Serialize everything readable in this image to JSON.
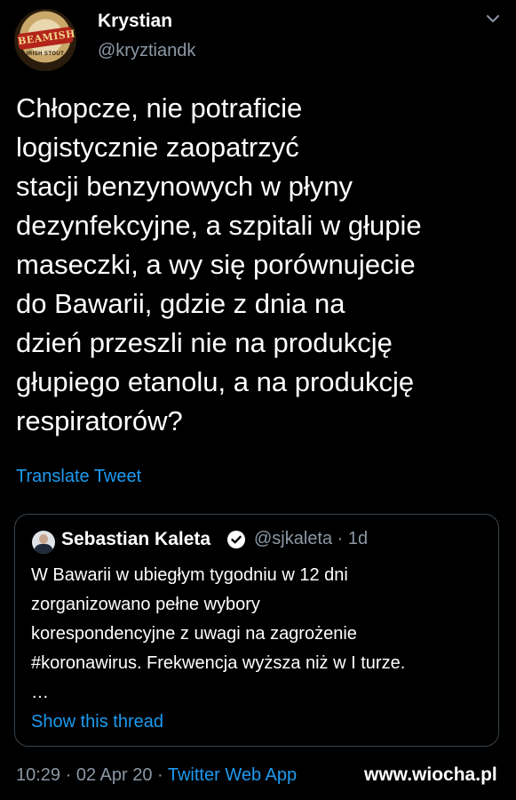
{
  "author": {
    "display_name": "Krystian",
    "handle": "@kryztiandk",
    "avatar_brand": "BEAMISH",
    "avatar_sub": "IRISH STOUT"
  },
  "tweet": {
    "lines": [
      "Chłopcze, nie potraficie",
      "logistycznie zaopatrzyć",
      "stacji benzynowych w płyny",
      "dezynfekcyjne, a szpitali w głupie",
      "maseczki, a wy się porównujecie",
      "do Bawarii, gdzie z dnia na",
      "dzień przeszli nie na produkcję",
      "głupiego etanolu, a na produkcję",
      "respiratorów?"
    ],
    "translate_label": "Translate Tweet"
  },
  "quoted": {
    "display_name": "Sebastian Kaleta",
    "handle_time": "@sjkaleta · 1d",
    "lines": [
      "W Bawarii w ubiegłym tygodniu w 12 dni",
      "zorganizowano pełne wybory",
      "korespondencyjne z uwagi na zagrożenie",
      "#koronawirus. Frekwencja wyższa niż w I turze.",
      "…"
    ],
    "show_thread_label": "Show this thread"
  },
  "meta": {
    "datetime": "10:29 · 02 Apr 20 · ",
    "source": "Twitter Web App"
  },
  "watermark": "www.wiocha.pl",
  "icons": {
    "menu": "chevron-down-icon",
    "verified": "verified-badge-icon"
  },
  "colors": {
    "background": "#000000",
    "link": "#1d9bf0",
    "secondary_text": "#8b98a5",
    "border": "#38444d"
  }
}
